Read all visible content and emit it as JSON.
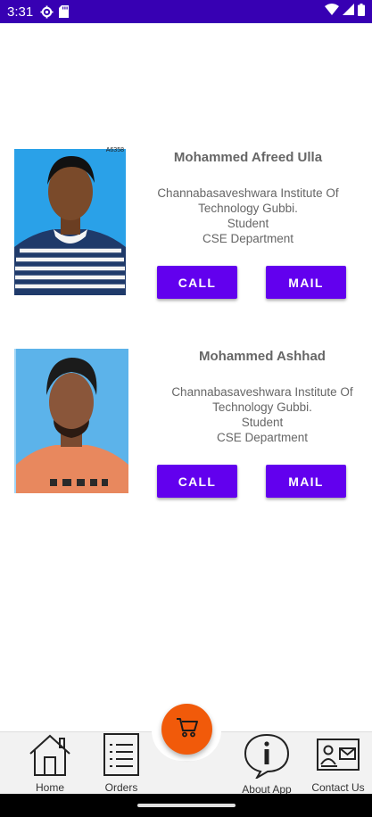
{
  "status_bar": {
    "time": "3:31",
    "background": "#3700b3",
    "left_icons": [
      "settings-gear-icon",
      "sd-card-icon"
    ],
    "right_icons": [
      "wifi-icon",
      "signal-icon",
      "battery-icon"
    ]
  },
  "theme": {
    "button_color": "#6200ee",
    "fab_color": "#f15a0a",
    "text_color": "#666666"
  },
  "contacts": [
    {
      "name": "Mohammed Afreed Ulla",
      "college": "Channabasaveshwara Institute Of Technology Gubbi.",
      "role": "Student",
      "department": "CSE Department",
      "photo_tag": "A6358",
      "call_label": "CALL",
      "mail_label": "MAIL"
    },
    {
      "name": "Mohammed Ashhad",
      "college": "Channabasaveshwara Institute Of Technology Gubbi.",
      "role": "Student",
      "department": "CSE Department",
      "call_label": "CALL",
      "mail_label": "MAIL"
    }
  ],
  "bottom_nav": {
    "home": "Home",
    "orders": "Orders",
    "about": "About App",
    "contact": "Contact Us",
    "fab_icon": "cart-icon"
  }
}
